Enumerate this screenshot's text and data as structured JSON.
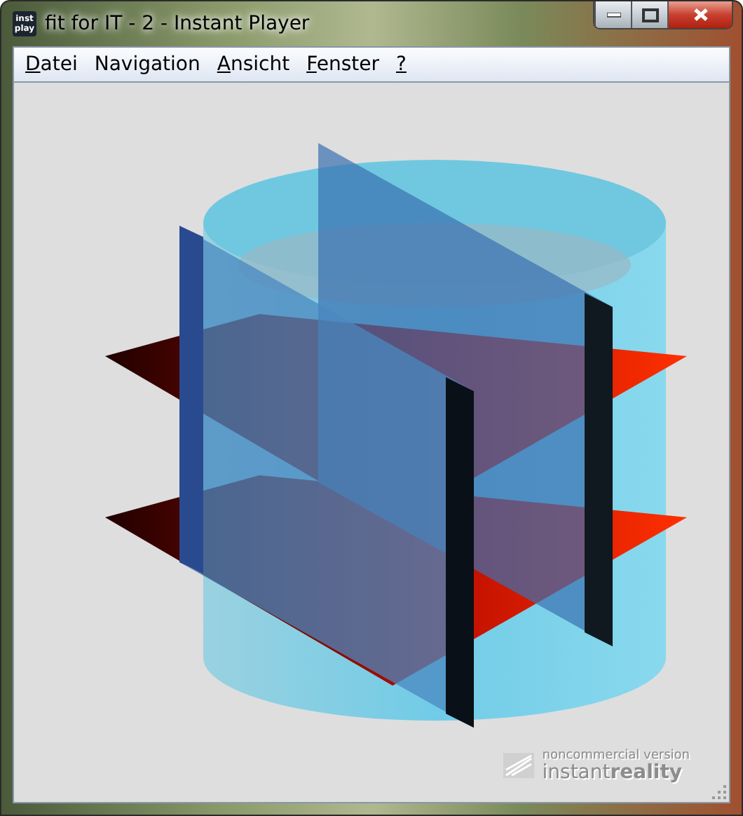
{
  "window": {
    "title": "fit for IT - 2 - Instant Player",
    "icon_lines": [
      "inst",
      "play"
    ]
  },
  "menu": [
    {
      "label": "Datei",
      "underline_first": true
    },
    {
      "label": "Navigation",
      "underline_first": false
    },
    {
      "label": "Ansicht",
      "underline_first": true
    },
    {
      "label": "Fenster",
      "underline_first": true
    },
    {
      "label": "?",
      "underline_first": true
    }
  ],
  "viewport": {
    "badge_line1": "noncommercial version",
    "badge_line2": "instant**reality**"
  }
}
